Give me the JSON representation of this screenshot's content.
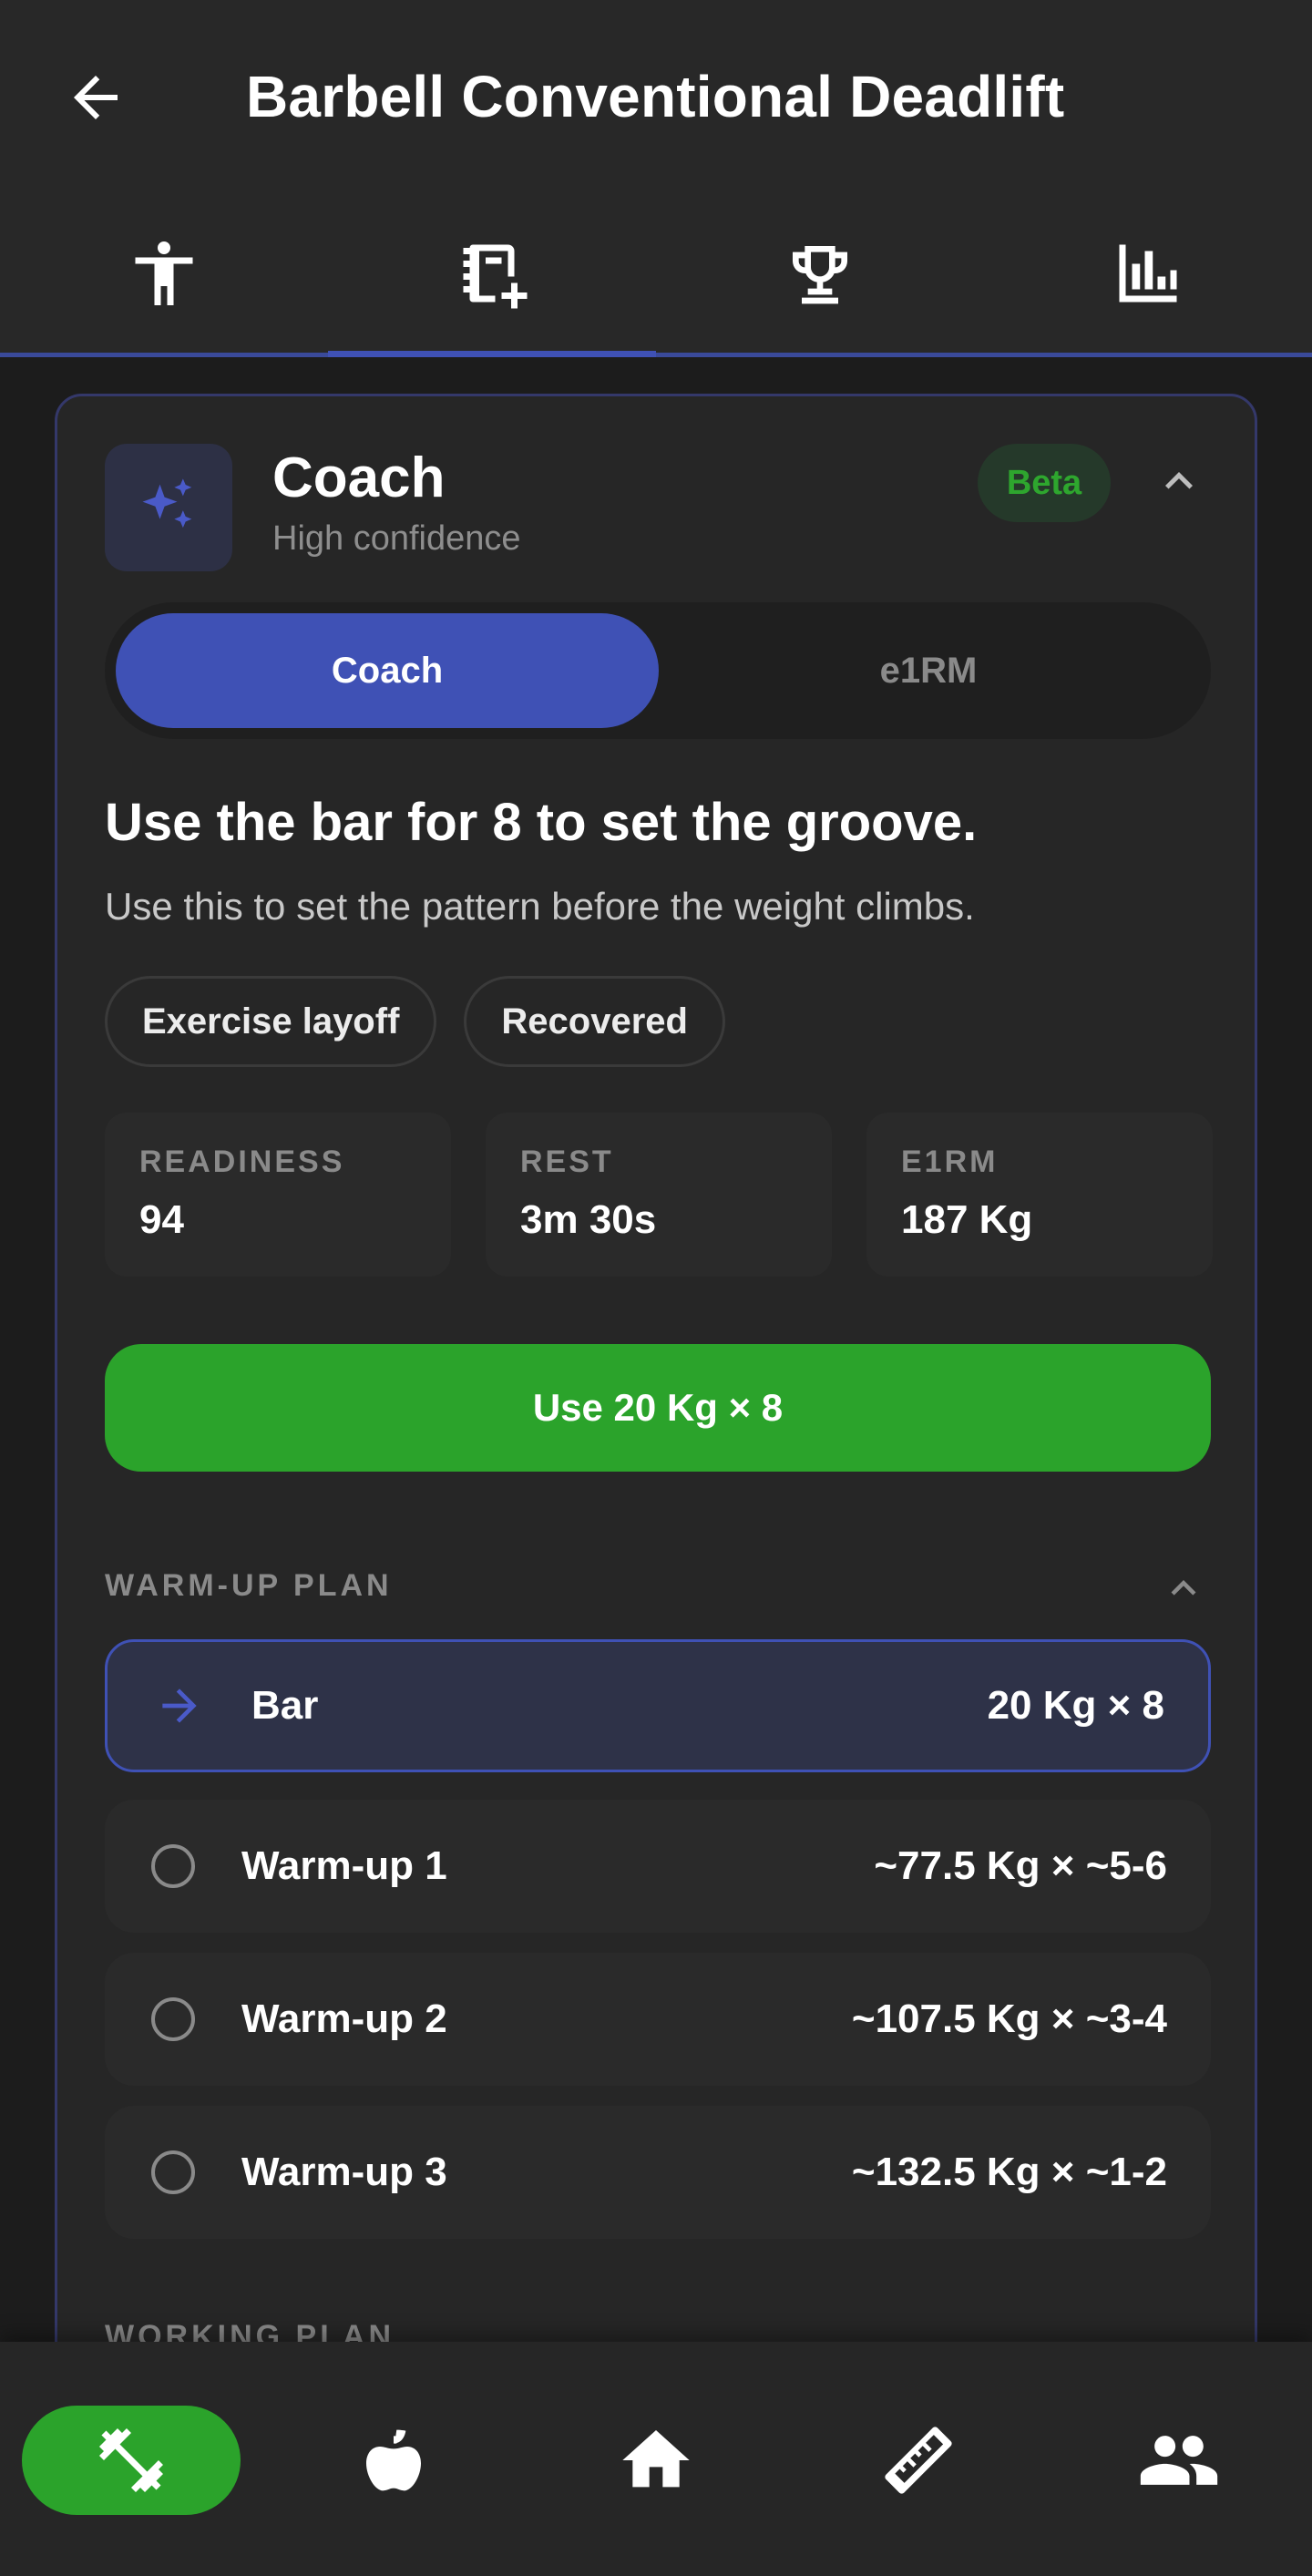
{
  "header": {
    "title": "Barbell Conventional Deadlift",
    "back_icon": "arrow-left-icon"
  },
  "tabs": [
    {
      "icon": "person-standing-icon",
      "active": false
    },
    {
      "icon": "notebook-plus-icon",
      "active": true
    },
    {
      "icon": "trophy-icon",
      "active": false
    },
    {
      "icon": "bar-chart-icon",
      "active": false
    }
  ],
  "coach": {
    "title": "Coach",
    "confidence": "High confidence",
    "badge": "Beta",
    "icon": "sparkles-icon",
    "segments": {
      "coach_label": "Coach",
      "e1rm_label": "e1RM",
      "selected": "Coach"
    },
    "headline": "Use the bar for 8 to set the groove.",
    "subtext": "Use this to set the pattern before the weight climbs.",
    "chips": [
      "Exercise layoff",
      "Recovered"
    ],
    "stats": [
      {
        "label": "READINESS",
        "value": "94"
      },
      {
        "label": "REST",
        "value": "3m 30s"
      },
      {
        "label": "E1RM",
        "value": "187 Kg"
      }
    ],
    "primary_action": "Use 20 Kg × 8",
    "warmup": {
      "title": "WARM-UP PLAN",
      "rows": [
        {
          "name": "Bar",
          "value": "20 Kg × 8",
          "current": true
        },
        {
          "name": "Warm-up 1",
          "value": "~77.5 Kg × ~5-6",
          "current": false
        },
        {
          "name": "Warm-up 2",
          "value": "~107.5 Kg × ~3-4",
          "current": false
        },
        {
          "name": "Warm-up 3",
          "value": "~132.5 Kg × ~1-2",
          "current": false
        }
      ]
    },
    "working_plan_title": "WORKING PLAN"
  },
  "bottom_nav": [
    {
      "icon": "dumbbell-icon",
      "active": true
    },
    {
      "icon": "apple-icon",
      "active": false
    },
    {
      "icon": "home-icon",
      "active": false
    },
    {
      "icon": "ruler-icon",
      "active": false
    },
    {
      "icon": "people-icon",
      "active": false
    }
  ],
  "colors": {
    "accent": "#3f51b5",
    "success": "#2ba32b",
    "surface": "#262626",
    "background": "#1c1c1c"
  }
}
